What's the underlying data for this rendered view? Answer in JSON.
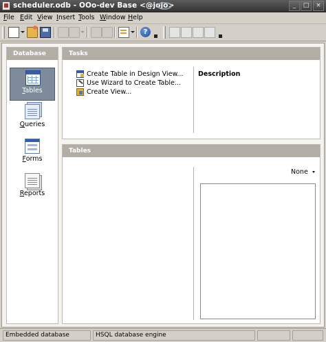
{
  "window": {
    "title": "scheduler.odb - OOo-dev Base <@jojo>",
    "buttons": {
      "minimize": "_",
      "maximize": "□",
      "close": "×"
    }
  },
  "menubar": {
    "items": [
      "File",
      "Edit",
      "View",
      "Insert",
      "Tools",
      "Window",
      "Help"
    ]
  },
  "toolbar": {
    "icons": [
      "new-document-icon",
      "open-folder-icon",
      "save-icon",
      "copy-icon",
      "paste-icon",
      "sort-ascending-icon",
      "sort-descending-icon",
      "form-icon",
      "help-icon"
    ],
    "help_label": "?"
  },
  "database_panel": {
    "title": "Database",
    "items": [
      {
        "label": "Tables",
        "icon": "tables-icon",
        "selected": true
      },
      {
        "label": "Queries",
        "icon": "queries-icon",
        "selected": false
      },
      {
        "label": "Forms",
        "icon": "forms-icon",
        "selected": false
      },
      {
        "label": "Reports",
        "icon": "reports-icon",
        "selected": false
      }
    ]
  },
  "tasks_panel": {
    "title": "Tasks",
    "tasks": [
      {
        "label": "Create Table in Design View...",
        "icon": "table-design-icon"
      },
      {
        "label": "Use Wizard to Create Table...",
        "icon": "table-wizard-icon"
      },
      {
        "label": "Create View...",
        "icon": "create-view-icon"
      }
    ],
    "description_title": "Description"
  },
  "tables_panel": {
    "title": "Tables",
    "preview_select": "None"
  },
  "statusbar": {
    "fields": [
      "Embedded database",
      "HSQL database engine",
      "",
      ""
    ]
  },
  "colors": {
    "titlebar": "#4a4a4a",
    "panel_header": "#b2aea6",
    "selected_item": "#7d8b9a",
    "window_bg": "#d4d0c8"
  }
}
